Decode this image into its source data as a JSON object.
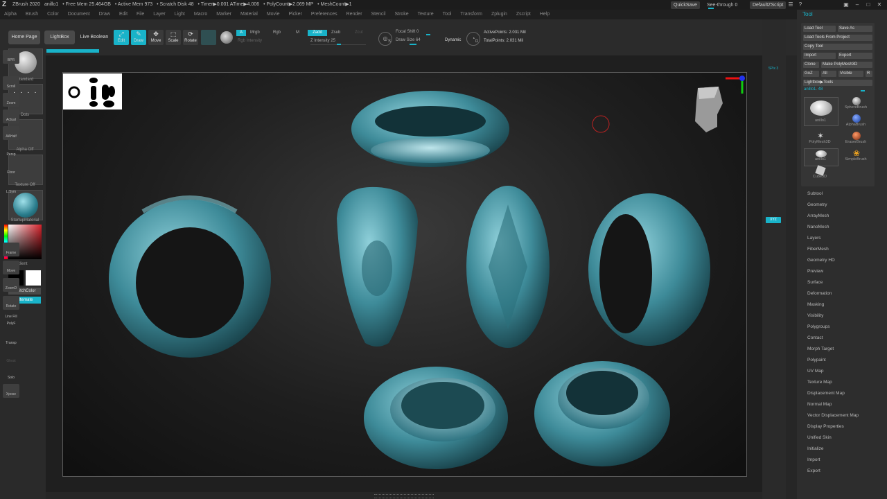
{
  "titlebar": {
    "app": "ZBrush 2020",
    "doc": "anillo1",
    "free_mem": "• Free Mem 25.464GB",
    "active_mem": "• Active Mem 973",
    "scratch": "• Scratch Disk 48",
    "timer": "• Timer▶0.001 ATime▶4.006",
    "polycount": "• PolyCount▶2.069 MP",
    "meshcount": "• MeshCount▶1",
    "quicksave": "QuickSave",
    "seethrough": "See-through  0",
    "script": "DefaultZScript"
  },
  "menu": [
    "Alpha",
    "Brush",
    "Color",
    "Document",
    "Draw",
    "Edit",
    "File",
    "Layer",
    "Light",
    "Macro",
    "Marker",
    "Material",
    "Movie",
    "Picker",
    "Preferences",
    "Render",
    "Stencil",
    "Stroke",
    "Texture",
    "Tool",
    "Transform",
    "Zplugin",
    "Zscript",
    "Help"
  ],
  "toolbar": {
    "home_page": "Home Page",
    "lightbox": "LightBox",
    "live_boolean": "Live Boolean",
    "edit": "Edit",
    "draw": "Draw",
    "move": "Move",
    "scale": "Scale",
    "rotate": "Rotate",
    "a": "A",
    "mrgb": "Mrgb",
    "rgb": "Rgb",
    "m": "M",
    "zadd": "Zadd",
    "zsub": "Zsub",
    "zcut": "Zcut",
    "rgb_intensity": "Rgb Intensity",
    "z_intensity": "Z Intensity  25",
    "focal_shift": "Focal Shift  0",
    "draw_size": "Draw Size  64",
    "dynamic": "Dynamic",
    "active_points": "ActivePoints: 2.031 Mil",
    "total_points": "TotalPoints: 2.031 Mil",
    "s": "S",
    "d": "D"
  },
  "left": {
    "standard": "Standard",
    "dots": "Dots",
    "alpha_off": "Alpha Off",
    "texture_off": "Texture Off",
    "material": "StartupMaterial",
    "gradient": "Gradient",
    "switch_color": "SwitchColor",
    "alternate": "Alternate"
  },
  "right_strip": [
    "BPR",
    "SPix 3",
    "Scroll",
    "Zoom",
    "Actual",
    "AAHalf",
    "Persp",
    "Floor",
    "L.Sym",
    "XYZ",
    "Frame",
    "Move",
    "ZoomD",
    "Rotate",
    "Line Fill PolyF",
    "Transp",
    "Ghost",
    "Solo",
    "Xpose"
  ],
  "tool": {
    "title": "Tool",
    "load_tool": "Load Tool",
    "save_as": "Save As",
    "load_from_project": "Load Tools From Project",
    "copy_tool": "Copy Tool",
    "import": "Import",
    "export": "Export",
    "clone": "Clone",
    "make_polymesh": "Make PolyMesh3D",
    "goz": "GoZ",
    "all": "All",
    "visible": "Visible",
    "r": "R",
    "lightbox_tools": "Lightbox▶Tools",
    "current": "anillo1. 48",
    "thumbs": [
      "anillo1",
      "SphereBrush",
      "PolyMesh3D",
      "AlphaBrush",
      "anillo1",
      "EraserBrush",
      "Cube3D",
      "SimpleBrush"
    ],
    "sections": [
      "Subtool",
      "Geometry",
      "ArrayMesh",
      "NanoMesh",
      "Layers",
      "FiberMesh",
      "Geometry HD",
      "Preview",
      "Surface",
      "Deformation",
      "Masking",
      "Visibility",
      "Polygroups",
      "Contact",
      "Morph Target",
      "Polypaint",
      "UV Map",
      "Texture Map",
      "Displacement Map",
      "Normal Map",
      "Vector Displacement Map",
      "Display Properties",
      "Unified Skin",
      "Initialize",
      "Import",
      "Export"
    ]
  },
  "colors": {
    "accent": "#19b3c9",
    "ring": "#3e8b99",
    "ring_light": "#7fc4cf"
  }
}
